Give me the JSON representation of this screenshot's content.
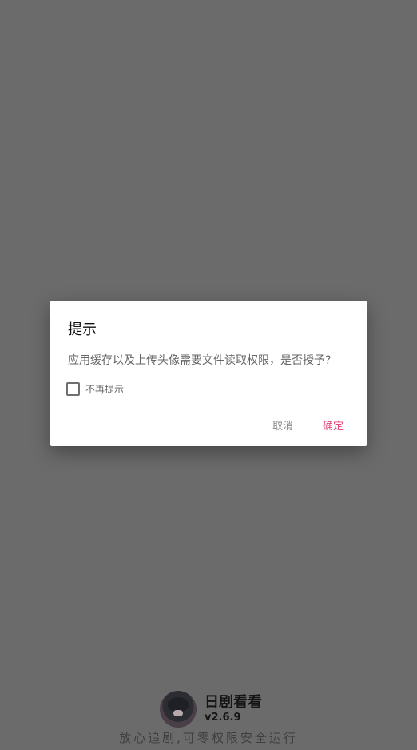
{
  "dialog": {
    "title": "提示",
    "message": "应用缓存以及上传头像需要文件读取权限，是否授予?",
    "checkbox_label": "不再提示",
    "cancel_label": "取消",
    "confirm_label": "确定"
  },
  "splash": {
    "app_name": "日剧看看",
    "version": "v2.6.9",
    "tagline": "放心追剧,可零权限安全运行"
  },
  "colors": {
    "overlay": "#6b6b6b",
    "accent": "#e0457b"
  }
}
